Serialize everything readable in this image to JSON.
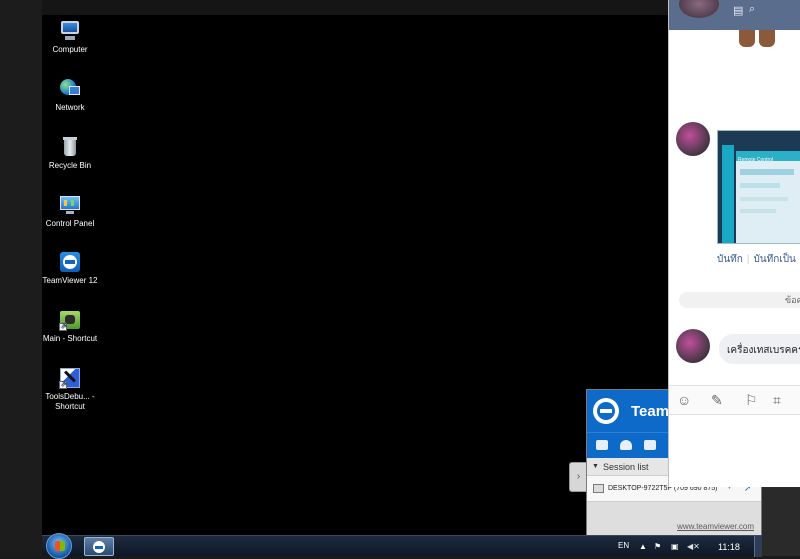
{
  "desktop": {
    "icons": [
      {
        "label": "Computer"
      },
      {
        "label": "Network"
      },
      {
        "label": "Recycle Bin"
      },
      {
        "label": "Control Panel"
      },
      {
        "label": "TeamViewer 12"
      },
      {
        "label": "Main - Shortcut"
      },
      {
        "label": "ToolsDebu... - Shortcut"
      }
    ]
  },
  "taskbar": {
    "language": "EN",
    "clock": "11:18",
    "tray_chevron": "▲"
  },
  "teamviewer": {
    "title": "Team",
    "session_header": "Session list",
    "device": "DESKTOP-9722T5P (709 690 875)",
    "url": "www.teamviewer.com",
    "side_tab_glyph": "›"
  },
  "chat": {
    "actions": [
      "บันทึก",
      "บันทึกเป็น"
    ],
    "date_fragment": "ข้อค",
    "message": "เครื่องเทสเบรคคร",
    "image_toolbar": "Remote Control"
  }
}
